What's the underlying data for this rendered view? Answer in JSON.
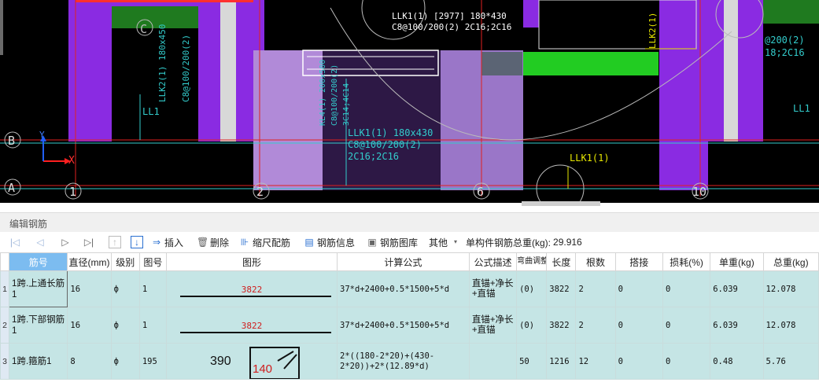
{
  "cad": {
    "axis_letters": [
      "C",
      "B",
      "A"
    ],
    "axis_numbers": [
      "1",
      "2",
      "6",
      "10"
    ],
    "axis_x_label": "X",
    "axis_y_label": "Y",
    "labels": {
      "top_beam_line1": "LLK1(1) [2977] 180*430",
      "top_beam_line2": "C8@100/200(2) 2C16;2C16",
      "vert_beam_a_line1": "LLK2(1) 180x450",
      "vert_beam_a_line2": "C8@100/200(2)",
      "vert_beam_b": "LLK2(1)",
      "kl_line1": "KL4(1) 200x500",
      "kl_line2": "C8@100/200(2)",
      "kl_line3": "3C14;4C14",
      "mid_beam_line1": "LLK1(1) 180x430",
      "mid_beam_line2": "C8@100/200(2)",
      "mid_beam_line3": "2C16;2C16",
      "ll1_left": "LL1",
      "ll1_right": "LL1",
      "llk1_bottom": "LLK1(1)",
      "right_line1": "@200(2)",
      "right_line2": "18;2C16"
    }
  },
  "panel": {
    "title": "编辑钢筋"
  },
  "toolbar": {
    "insert": "插入",
    "delete": "删除",
    "scale_rebar": "缩尺配筋",
    "rebar_info": "钢筋信息",
    "rebar_library": "钢筋图库",
    "other": "其他",
    "total_weight_label": "单构件钢筋总重(kg):",
    "total_weight_value": "29.916"
  },
  "grid": {
    "headers": [
      "筋号",
      "直径(mm)",
      "级别",
      "图号",
      "图形",
      "计算公式",
      "公式描述",
      "弯曲调整",
      "长度",
      "根数",
      "搭接",
      "损耗(%)",
      "单重(kg)",
      "总重(kg)"
    ],
    "rows": [
      {
        "num": "1",
        "name": "1跨.上通长筋1",
        "diameter": "16",
        "grade": "ф",
        "figure_no": "1",
        "shape_length": "3822",
        "formula": "37*d+2400+0.5*1500+5*d",
        "desc": "直锚+净长+直锚",
        "bend": "(0)",
        "length": "3822",
        "count": "2",
        "lap": "0",
        "loss": "0",
        "unit_weight": "6.039",
        "total_weight": "12.078"
      },
      {
        "num": "2",
        "name": "1跨.下部钢筋1",
        "diameter": "16",
        "grade": "ф",
        "figure_no": "1",
        "shape_length": "3822",
        "formula": "37*d+2400+0.5*1500+5*d",
        "desc": "直锚+净长+直锚",
        "bend": "(0)",
        "length": "3822",
        "count": "2",
        "lap": "0",
        "loss": "0",
        "unit_weight": "6.039",
        "total_weight": "12.078"
      },
      {
        "num": "3",
        "name": "1跨.箍筋1",
        "diameter": "8",
        "grade": "ф",
        "figure_no": "195",
        "stirrup_height": "390",
        "stirrup_width": "140",
        "formula": "2*((180-2*20)+(430-2*20))+2*(12.89*d)",
        "desc": "",
        "bend": "50",
        "length": "1216",
        "count": "12",
        "lap": "0",
        "loss": "0",
        "unit_weight": "0.48",
        "total_weight": "5.76"
      }
    ]
  }
}
